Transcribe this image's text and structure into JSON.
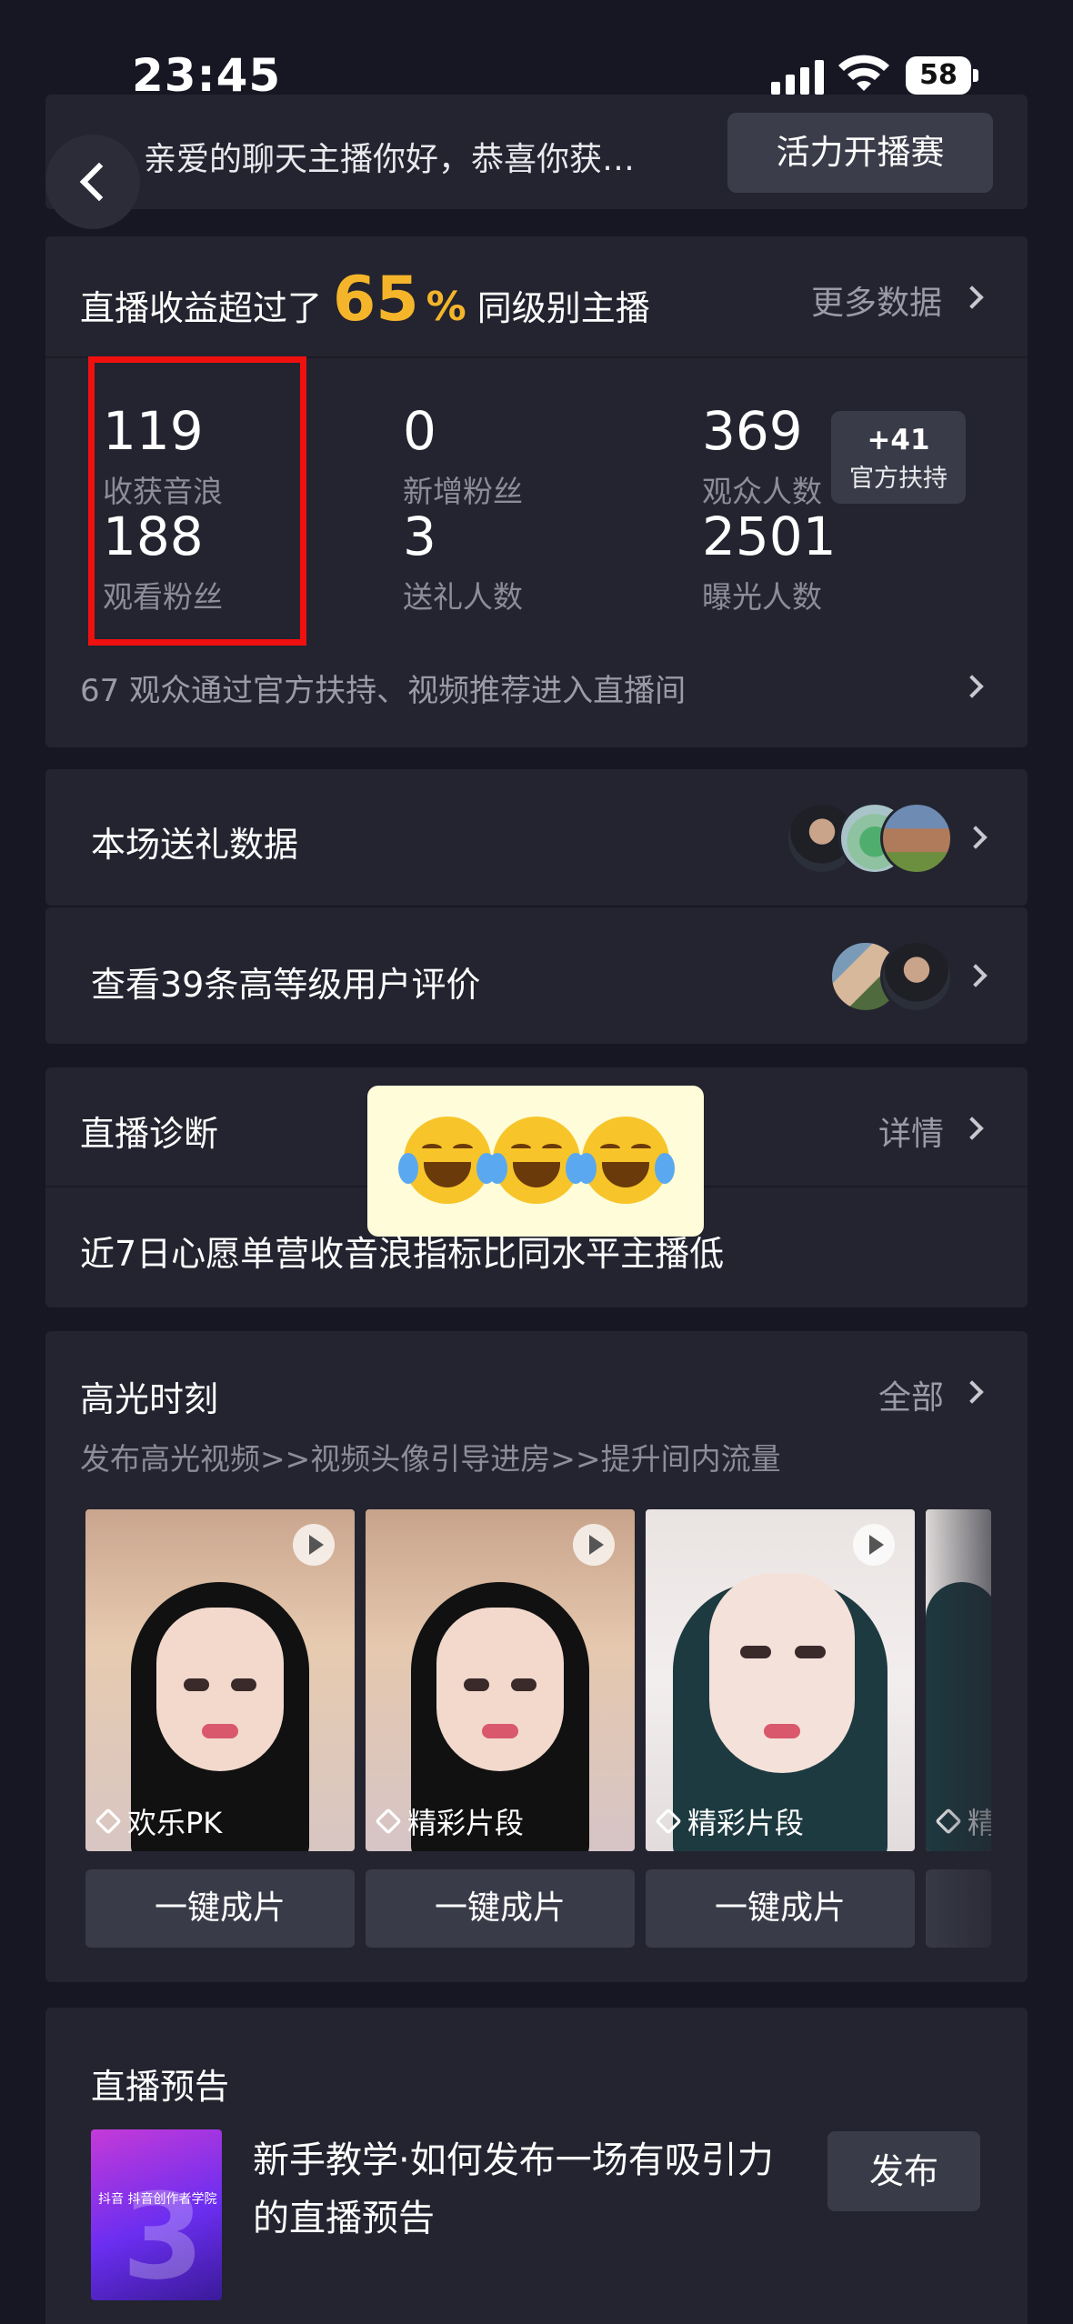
{
  "status_bar": {
    "time": "23:45",
    "battery": "58"
  },
  "banner": {
    "text": "亲爱的聊天主播你好，恭喜你获…",
    "button": "活力开播赛"
  },
  "stats": {
    "headline_prefix": "直播收益超过了",
    "percent": "65",
    "percent_sign": "%",
    "headline_suffix": "同级别主播",
    "more_data": "更多数据",
    "metrics": [
      {
        "value": "119",
        "label": "收获音浪"
      },
      {
        "value": "0",
        "label": "新增粉丝"
      },
      {
        "value": "369",
        "label": "观众人数"
      },
      {
        "value": "188",
        "label": "观看粉丝"
      },
      {
        "value": "3",
        "label": "送礼人数"
      },
      {
        "value": "2501",
        "label": "曝光人数"
      }
    ],
    "boost": {
      "value": "+41",
      "label": "官方扶持"
    },
    "footnote": "67 观众通过官方扶持、视频推荐进入直播间",
    "highlight_color": "#f01010",
    "accent_color": "#f5b52a"
  },
  "gift_row": {
    "title": "本场送礼数据"
  },
  "review_row": {
    "title": "查看39条高等级用户评价"
  },
  "diagnosis": {
    "title": "直播诊断",
    "detail": "详情",
    "text": "近7日心愿单营收音浪指标比同水平主播低",
    "overlay_emojis": [
      "face-with-tears-of-joy",
      "face-with-tears-of-joy",
      "face-with-tears-of-joy"
    ]
  },
  "highlights": {
    "title": "高光时刻",
    "all": "全部",
    "subtitle": "发布高光视频>>视频头像引导进房>>提升间内流量",
    "clips": [
      {
        "caption": "欢乐PK",
        "button": "一键成片"
      },
      {
        "caption": "精彩片段",
        "button": "一键成片"
      },
      {
        "caption": "精彩片段",
        "button": "一键成片"
      },
      {
        "caption": "精",
        "button": ""
      }
    ]
  },
  "preview": {
    "title": "直播预告",
    "item_title": "新手教学·如何发布一场有吸引力的直播预告",
    "thumb_tag": "抖音 抖音创作者学院",
    "button": "发布"
  }
}
